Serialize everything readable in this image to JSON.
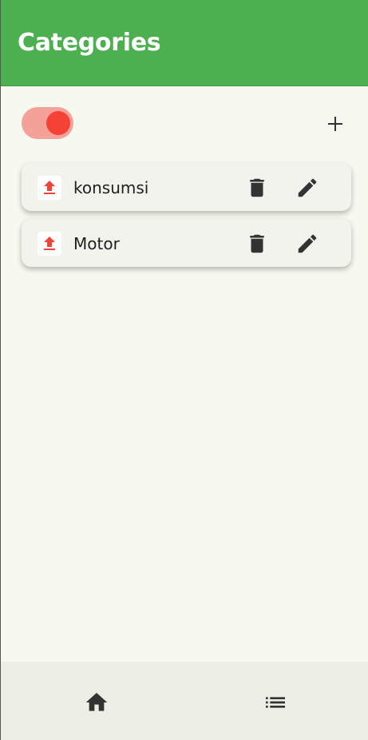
{
  "app_bar": {
    "title": "Categories"
  },
  "controls": {
    "type_toggle": {
      "state": "on",
      "color": "#f44336"
    },
    "add_icon": "plus-icon"
  },
  "categories": [
    {
      "name": "konsumsi",
      "icon": "upload-icon"
    },
    {
      "name": "Motor",
      "icon": "upload-icon"
    }
  ],
  "bottom_nav": {
    "items": [
      {
        "icon": "home-icon"
      },
      {
        "icon": "list-icon"
      }
    ]
  },
  "colors": {
    "primary": "#4caf50",
    "accent": "#f44336",
    "background": "#f7f9f0",
    "card": "#f2f3ec",
    "nav": "#edefe6"
  }
}
